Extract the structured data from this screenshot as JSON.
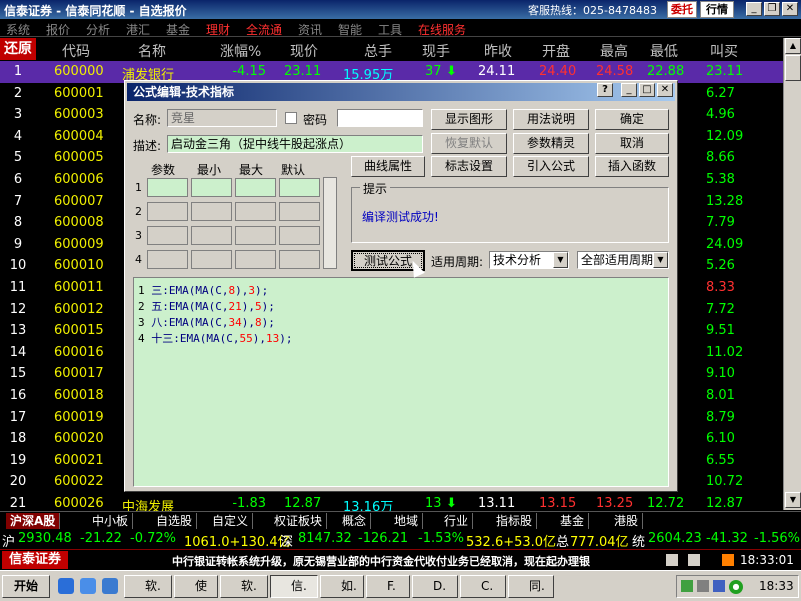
{
  "window": {
    "title": "信泰证券 - 信泰同花顺 - 自选报价",
    "hotline": "客服热线：025-8478483",
    "buttons": [
      "委托",
      "行情"
    ]
  },
  "menu": [
    "系统",
    "报价",
    "分析",
    "港汇",
    "基金",
    "理财",
    "全流通",
    "资讯",
    "智能",
    "工具",
    "在线服务"
  ],
  "columns": [
    "还原",
    "代码",
    "名称",
    "涨幅%",
    "现价",
    "总手",
    "现手",
    "昨收",
    "开盘",
    "最高",
    "最低",
    "叫买"
  ],
  "rows": [
    {
      "idx": "1",
      "code": "600000",
      "name": "浦发银行",
      "chg": "-4.15",
      "price": "23.11",
      "vol": "15.95万",
      "cur": "37",
      "prev": "24.11",
      "open": "24.40",
      "hi": "24.58",
      "lo": "22.88",
      "bid": "23.11",
      "sel": true
    },
    {
      "idx": "2",
      "code": "600001",
      "bid": "6.27"
    },
    {
      "idx": "3",
      "code": "600003",
      "bid": "4.96"
    },
    {
      "idx": "4",
      "code": "600004",
      "bid": "12.09"
    },
    {
      "idx": "5",
      "code": "600005",
      "bid": "8.66"
    },
    {
      "idx": "6",
      "code": "600006",
      "bid": "5.38"
    },
    {
      "idx": "7",
      "code": "600007",
      "bid": "13.28"
    },
    {
      "idx": "8",
      "code": "600008",
      "bid": "7.79"
    },
    {
      "idx": "9",
      "code": "600009",
      "bid": "24.09"
    },
    {
      "idx": "10",
      "code": "600010",
      "bid": "5.26"
    },
    {
      "idx": "11",
      "code": "600011",
      "bid": "8.33",
      "bidRed": true
    },
    {
      "idx": "12",
      "code": "600012",
      "bid": "7.72"
    },
    {
      "idx": "13",
      "code": "600015",
      "bid": "9.51"
    },
    {
      "idx": "14",
      "code": "600016",
      "bid": "11.02"
    },
    {
      "idx": "15",
      "code": "600017",
      "bid": "9.10"
    },
    {
      "idx": "16",
      "code": "600018",
      "bid": "8.01"
    },
    {
      "idx": "17",
      "code": "600019",
      "bid": "8.79"
    },
    {
      "idx": "18",
      "code": "600020",
      "bid": "6.10"
    },
    {
      "idx": "19",
      "code": "600021",
      "bid": "6.55"
    },
    {
      "idx": "20",
      "code": "600022",
      "bid": "10.72"
    },
    {
      "idx": "21",
      "code": "600026",
      "name": "中海发展",
      "chg": "-1.83",
      "price": "12.87",
      "vol": "13.16万",
      "cur": "13",
      "prev": "13.11",
      "open": "13.15",
      "hi": "13.25",
      "lo": "12.72",
      "bid": "12.87"
    }
  ],
  "tabs": [
    "沪深A股",
    "中小板",
    "自选股",
    "自定义",
    "权证板块",
    "概念",
    "地域",
    "行业",
    "指标股",
    "基金",
    "港股"
  ],
  "index_bar": {
    "sh_label": "沪",
    "sh_val": "2930.48",
    "sh_chg": "-21.22",
    "sh_pct": "-0.72%",
    "sh_amt": "1061.0+130.4亿",
    "sz_label": "深",
    "sz_val": "8147.32",
    "sz_chg": "-126.21",
    "sz_pct": "-1.53%",
    "sz_amt": "532.6+53.0亿",
    "zong_label": "总",
    "zong_amt": "777.04亿",
    "tong_label": "统",
    "tong_val": "2604.23",
    "tong_chg": "-41.32",
    "tong_pct": "-1.56%"
  },
  "ticker": {
    "logo": "信泰证券",
    "news": "中行银证转帐系统升级，原无锡营业部的中行资金代收付业务已经取消，现在起办理银",
    "time": "18:33:01"
  },
  "dialog": {
    "title": "公式编辑-技术指标",
    "name_label": "名称:",
    "name_value": "竞星",
    "pwd_label": "密码",
    "desc_label": "描述:",
    "desc_value": "启动金三角（捉中线牛股起涨点）",
    "buttons": {
      "show_graph": "显示图形",
      "usage": "用法说明",
      "ok": "确定",
      "restore": "恢复默认",
      "param_tune": "参数精灵",
      "cancel": "取消",
      "curve_attr": "曲线属性",
      "flag_set": "标志设置",
      "import": "引入公式",
      "insert_func": "插入函数",
      "test": "测试公式"
    },
    "param_headers": [
      "参数",
      "最小",
      "最大",
      "默认"
    ],
    "param_rows": [
      "1",
      "2",
      "3",
      "4"
    ],
    "hint_title": "提示",
    "hint_msg": "编译测试成功!",
    "period_label": "适用周期:",
    "period_value": "技术分析",
    "period_all": "全部适用周期",
    "code_lines": [
      {
        "n": "1",
        "pre": "三:EMA(MA(C,",
        "a": "8",
        "mid": "),",
        "b": "3",
        "post": ");"
      },
      {
        "n": "2",
        "pre": "五:EMA(MA(C,",
        "a": "21",
        "mid": "),",
        "b": "5",
        "post": ");"
      },
      {
        "n": "3",
        "pre": "八:EMA(MA(C,",
        "a": "34",
        "mid": "),",
        "b": "8",
        "post": ");"
      },
      {
        "n": "4",
        "pre": "十三:EMA(MA(C,",
        "a": "55",
        "mid": "),",
        "b": "13",
        "post": ");"
      }
    ]
  },
  "taskbar": {
    "start": "开始",
    "tasks": [
      "软.",
      "使",
      "软.",
      "信.",
      "如.",
      "F.",
      "D.",
      "C.",
      "同."
    ],
    "clock": "18:33"
  },
  "icons": {
    "down_arrow": "arrow-down",
    "question": "help-icon"
  }
}
